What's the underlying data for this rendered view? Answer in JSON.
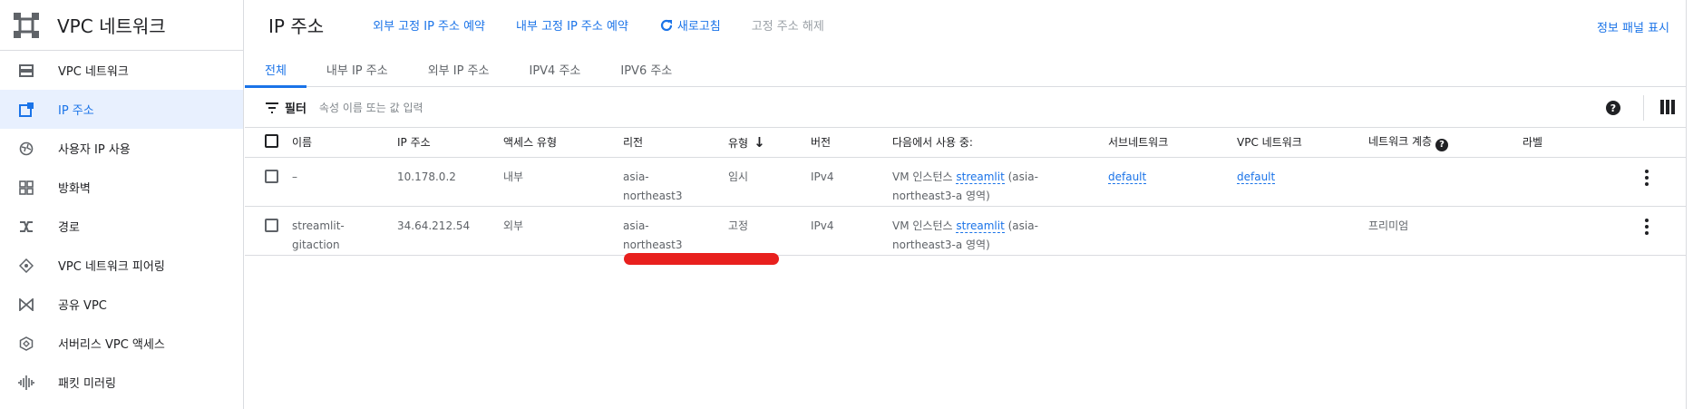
{
  "app": {
    "title": "VPC 네트워크"
  },
  "sidebar": {
    "items": [
      {
        "label": "VPC 네트워크",
        "icon": "vpc-network-icon",
        "active": false
      },
      {
        "label": "IP 주소",
        "icon": "ip-address-icon",
        "active": true
      },
      {
        "label": "사용자 IP 사용",
        "icon": "globe-icon",
        "active": false
      },
      {
        "label": "방화벽",
        "icon": "firewall-icon",
        "active": false
      },
      {
        "label": "경로",
        "icon": "routes-icon",
        "active": false
      },
      {
        "label": "VPC 네트워크 피어링",
        "icon": "peering-icon",
        "active": false
      },
      {
        "label": "공유 VPC",
        "icon": "shared-vpc-icon",
        "active": false
      },
      {
        "label": "서버리스 VPC 액세스",
        "icon": "serverless-icon",
        "active": false
      },
      {
        "label": "패킷 미러링",
        "icon": "packet-mirroring-icon",
        "active": false
      }
    ]
  },
  "header": {
    "title": "IP 주소",
    "actions": {
      "reserve_external": "외부 고정 IP 주소 예약",
      "reserve_internal": "내부 고정 IP 주소 예약",
      "refresh": "새로고침",
      "release": "고정 주소 해제"
    },
    "info_panel": "정보 패널 표시"
  },
  "tabs": [
    "전체",
    "내부 IP 주소",
    "외부 IP 주소",
    "IPV4 주소",
    "IPV6 주소"
  ],
  "filter": {
    "label": "필터",
    "placeholder": "속성 이름 또는 값 입력"
  },
  "table": {
    "columns": [
      "이름",
      "IP 주소",
      "액세스 유형",
      "리전",
      "유형",
      "버전",
      "다음에서 사용 중:",
      "서브네트워크",
      "VPC 네트워크",
      "네트워크 계층",
      "라벨"
    ],
    "rows": [
      {
        "name": "–",
        "ip": "10.178.0.2",
        "access": "내부",
        "region_l1": "asia-",
        "region_l2": "northeast3",
        "type": "임시",
        "version": "IPv4",
        "used_by_prefix": "VM 인스턴스 ",
        "used_by_link": "streamlit",
        "used_by_suffix_l1": " (asia-",
        "used_by_l2": "northeast3-a 영역)",
        "subnet": "default",
        "vpc": "default",
        "tier": "",
        "labels": ""
      },
      {
        "name_l1": "streamlit-",
        "name_l2": "gitaction",
        "ip": "34.64.212.54",
        "access": "외부",
        "region_l1": "asia-",
        "region_l2": "northeast3",
        "type": "고정",
        "version": "IPv4",
        "used_by_prefix": "VM 인스턴스 ",
        "used_by_link": "streamlit",
        "used_by_suffix_l1": " (asia-",
        "used_by_l2": "northeast3-a 영역)",
        "subnet": "",
        "vpc": "",
        "tier": "프리미엄",
        "labels": ""
      }
    ]
  },
  "colors": {
    "accent": "#1a73e8",
    "highlight_mark": "#e8201e"
  }
}
